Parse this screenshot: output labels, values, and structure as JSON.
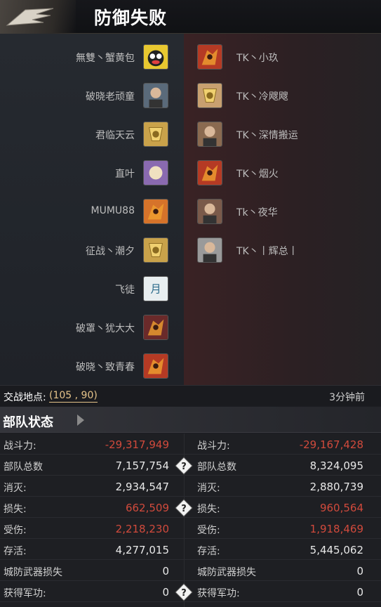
{
  "header": {
    "title": "防御失败"
  },
  "left_players": [
    {
      "name": "無雙丶蟹黄包",
      "avatar_icon": "cartoon-cat-avatar",
      "color": "#e8c830"
    },
    {
      "name": "破晓老顽童",
      "avatar_icon": "man-portrait-avatar",
      "color": "#5a6a7a"
    },
    {
      "name": "君临天云",
      "avatar_icon": "gold-crest-avatar",
      "color": "#c9a24a"
    },
    {
      "name": "直叶",
      "avatar_icon": "cartoon-character-avatar",
      "color": "#8a6ab0"
    },
    {
      "name": "MUMU88",
      "avatar_icon": "fire-dragon-avatar",
      "color": "#d6732a"
    },
    {
      "name": "征战丶潮夕",
      "avatar_icon": "gold-crest-avatar",
      "color": "#c9a24a"
    },
    {
      "name": "飞徒",
      "avatar_icon": "text-logo-avatar",
      "color": "#e8eef0"
    },
    {
      "name": "破罩丶犹大大",
      "avatar_icon": "dark-dragon-avatar",
      "color": "#6a2a2a"
    },
    {
      "name": "破晓丶致青春",
      "avatar_icon": "red-dragon-avatar",
      "color": "#b53a24"
    }
  ],
  "right_players": [
    {
      "name": "TK丶小玖",
      "avatar_icon": "red-dragon-avatar",
      "color": "#b53a24"
    },
    {
      "name": "TK丶冷飕飕",
      "avatar_icon": "winged-crest-avatar",
      "color": "#c8a070"
    },
    {
      "name": "TK丶深情搬运",
      "avatar_icon": "warrior-portrait-avatar",
      "color": "#8a6a50"
    },
    {
      "name": "TK丶烟火",
      "avatar_icon": "red-dragon-avatar",
      "color": "#b53a24"
    },
    {
      "name": "Tk丶夜华",
      "avatar_icon": "woman-portrait-avatar",
      "color": "#7a5a4a"
    },
    {
      "name": "TK丶丨辉总丨",
      "avatar_icon": "man-standing-avatar",
      "color": "#9a9a9a"
    }
  ],
  "location": {
    "label": "交战地点:",
    "coord": "(105 , 90)",
    "time": "3分钟前"
  },
  "section": {
    "title": "部队状态"
  },
  "stats": [
    {
      "label": "战斗力:",
      "left": "-29,317,949",
      "right": "-29,167,428",
      "color": "red",
      "help": false
    },
    {
      "label": "部队总数",
      "left": "7,157,754",
      "right": "8,324,095",
      "color": "white",
      "help": true
    },
    {
      "label": "消灭:",
      "left": "2,934,547",
      "right": "2,880,739",
      "color": "white",
      "help": false
    },
    {
      "label": "损失:",
      "left": "662,509",
      "right": "960,564",
      "color": "red",
      "help": true
    },
    {
      "label": "受伤:",
      "left": "2,218,230",
      "right": "1,918,469",
      "color": "red",
      "help": false
    },
    {
      "label": "存活:",
      "left": "4,277,015",
      "right": "5,445,062",
      "color": "white",
      "help": false
    },
    {
      "label": "城防武器损失",
      "left": "0",
      "right": "0",
      "color": "white",
      "help": false
    },
    {
      "label": "获得军功:",
      "left": "0",
      "right": "0",
      "color": "white",
      "help": true
    }
  ]
}
